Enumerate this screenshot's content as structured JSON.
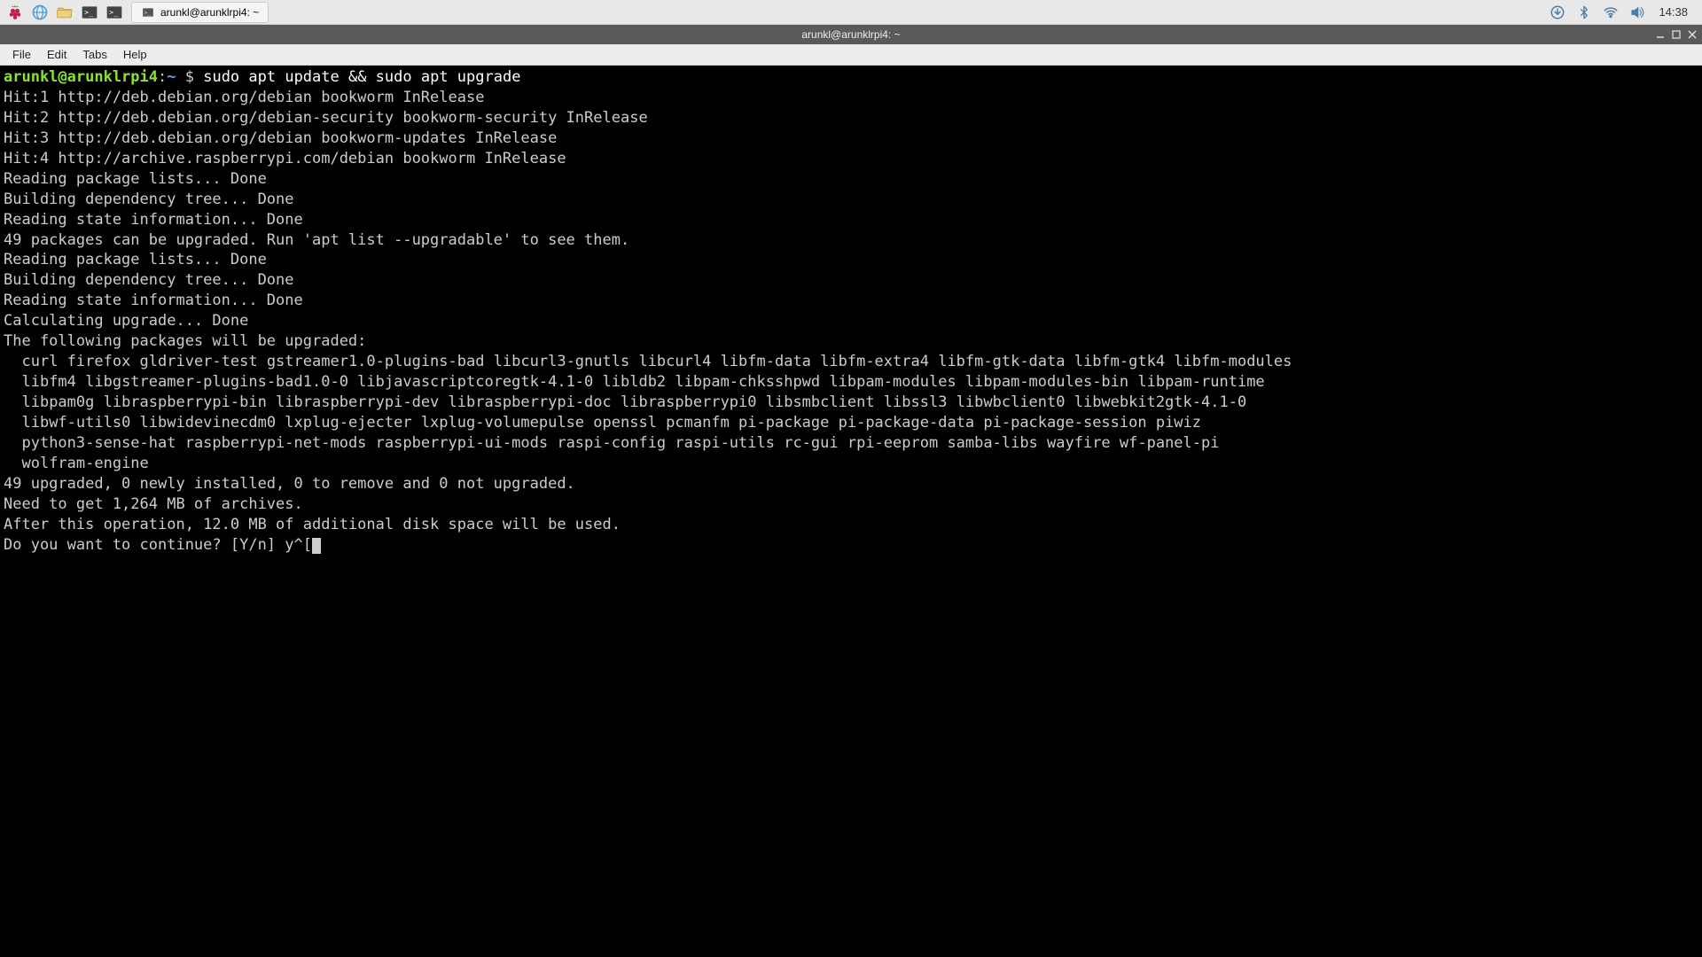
{
  "taskbar": {
    "active_task": "arunkl@arunklrpi4: ~",
    "clock": "14:38"
  },
  "window": {
    "title": "arunkl@arunklrpi4: ~",
    "menu": [
      "File",
      "Edit",
      "Tabs",
      "Help"
    ]
  },
  "terminal": {
    "prompt_user": "arunkl@arunklrpi4",
    "prompt_path": "~",
    "command": "sudo apt update && sudo apt upgrade",
    "lines": [
      "Hit:1 http://deb.debian.org/debian bookworm InRelease",
      "Hit:2 http://deb.debian.org/debian-security bookworm-security InRelease",
      "Hit:3 http://deb.debian.org/debian bookworm-updates InRelease",
      "Hit:4 http://archive.raspberrypi.com/debian bookworm InRelease",
      "Reading package lists... Done",
      "Building dependency tree... Done",
      "Reading state information... Done",
      "49 packages can be upgraded. Run 'apt list --upgradable' to see them.",
      "Reading package lists... Done",
      "Building dependency tree... Done",
      "Reading state information... Done",
      "Calculating upgrade... Done",
      "The following packages will be upgraded:",
      "  curl firefox gldriver-test gstreamer1.0-plugins-bad libcurl3-gnutls libcurl4 libfm-data libfm-extra4 libfm-gtk-data libfm-gtk4 libfm-modules",
      "  libfm4 libgstreamer-plugins-bad1.0-0 libjavascriptcoregtk-4.1-0 libldb2 libpam-chksshpwd libpam-modules libpam-modules-bin libpam-runtime",
      "  libpam0g libraspberrypi-bin libraspberrypi-dev libraspberrypi-doc libraspberrypi0 libsmbclient libssl3 libwbclient0 libwebkit2gtk-4.1-0",
      "  libwf-utils0 libwidevinecdm0 lxplug-ejecter lxplug-volumepulse openssl pcmanfm pi-package pi-package-data pi-package-session piwiz",
      "  python3-sense-hat raspberrypi-net-mods raspberrypi-ui-mods raspi-config raspi-utils rc-gui rpi-eeprom samba-libs wayfire wf-panel-pi",
      "  wolfram-engine",
      "49 upgraded, 0 newly installed, 0 to remove and 0 not upgraded.",
      "Need to get 1,264 MB of archives.",
      "After this operation, 12.0 MB of additional disk space will be used."
    ],
    "final_prompt": "Do you want to continue? [Y/n] ",
    "typed_response": "y^["
  }
}
